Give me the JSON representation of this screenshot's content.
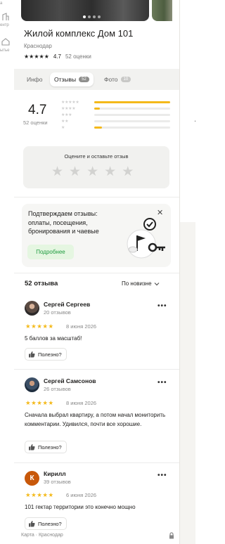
{
  "left_strip": {
    "label_1": "а",
    "label_2": "ентр",
    "label_3": "ытье"
  },
  "card": {
    "title": "Жилой комплекс Дом 101",
    "city": "Краснодар",
    "stars": "★★★★★",
    "rating": "4.7",
    "ratings_count": "52 оценки"
  },
  "tabs": [
    {
      "label": "Инфо"
    },
    {
      "label": "Отзывы",
      "badge": "52"
    },
    {
      "label": "Фото",
      "badge": "10"
    }
  ],
  "summary": {
    "score": "4.7",
    "subtitle": "52 оценки",
    "distribution": [
      {
        "stars": "★★★★★",
        "fraction": 1.0
      },
      {
        "stars": "★★★★",
        "fraction": 0.07
      },
      {
        "stars": "★★★",
        "fraction": 0.0
      },
      {
        "stars": "★★",
        "fraction": 0.0
      },
      {
        "stars": "★",
        "fraction": 0.1
      }
    ]
  },
  "rate_box": {
    "prompt": "Оцените и оставьте отзыв",
    "empty_star": "★"
  },
  "promo": {
    "text": "Подтверждаем отзывы: оплаты, посещения, бронирования и чаевые",
    "button": "Подробнее",
    "close": "✕"
  },
  "reviews_header": {
    "count": "52 отзыва",
    "sort": "По новизне"
  },
  "reviews": [
    {
      "name": "Сергей Сергеев",
      "count": "20 отзывов",
      "stars": "★★★★★",
      "date": "8 июня 2026",
      "text": "5 баллов за масштаб!",
      "helpful": "Полезно?",
      "more": "•••",
      "initial": ""
    },
    {
      "name": "Сергей Самсонов",
      "count": "26 отзывов",
      "stars": "★★★★★",
      "date": "8 июня 2026",
      "text": "Сначала выбрал квартиру, а потом начал мониторить комментарии. Удивился, почти все хорошие.",
      "helpful": "Полезно?",
      "more": "•••",
      "initial": ""
    },
    {
      "name": "Кирилл",
      "count": "39 отзывов",
      "stars": "★★★★★",
      "date": "6 июня 2026",
      "text": "101 гектар территории это конечно мощно",
      "helpful": "Полезно?",
      "more": "•••",
      "initial": "К"
    }
  ],
  "footer": {
    "breadcrumb": "Карта · Краснодар"
  },
  "colors": {
    "star_accent": "#f4b91a",
    "promo_green": "#1f9c3f"
  }
}
